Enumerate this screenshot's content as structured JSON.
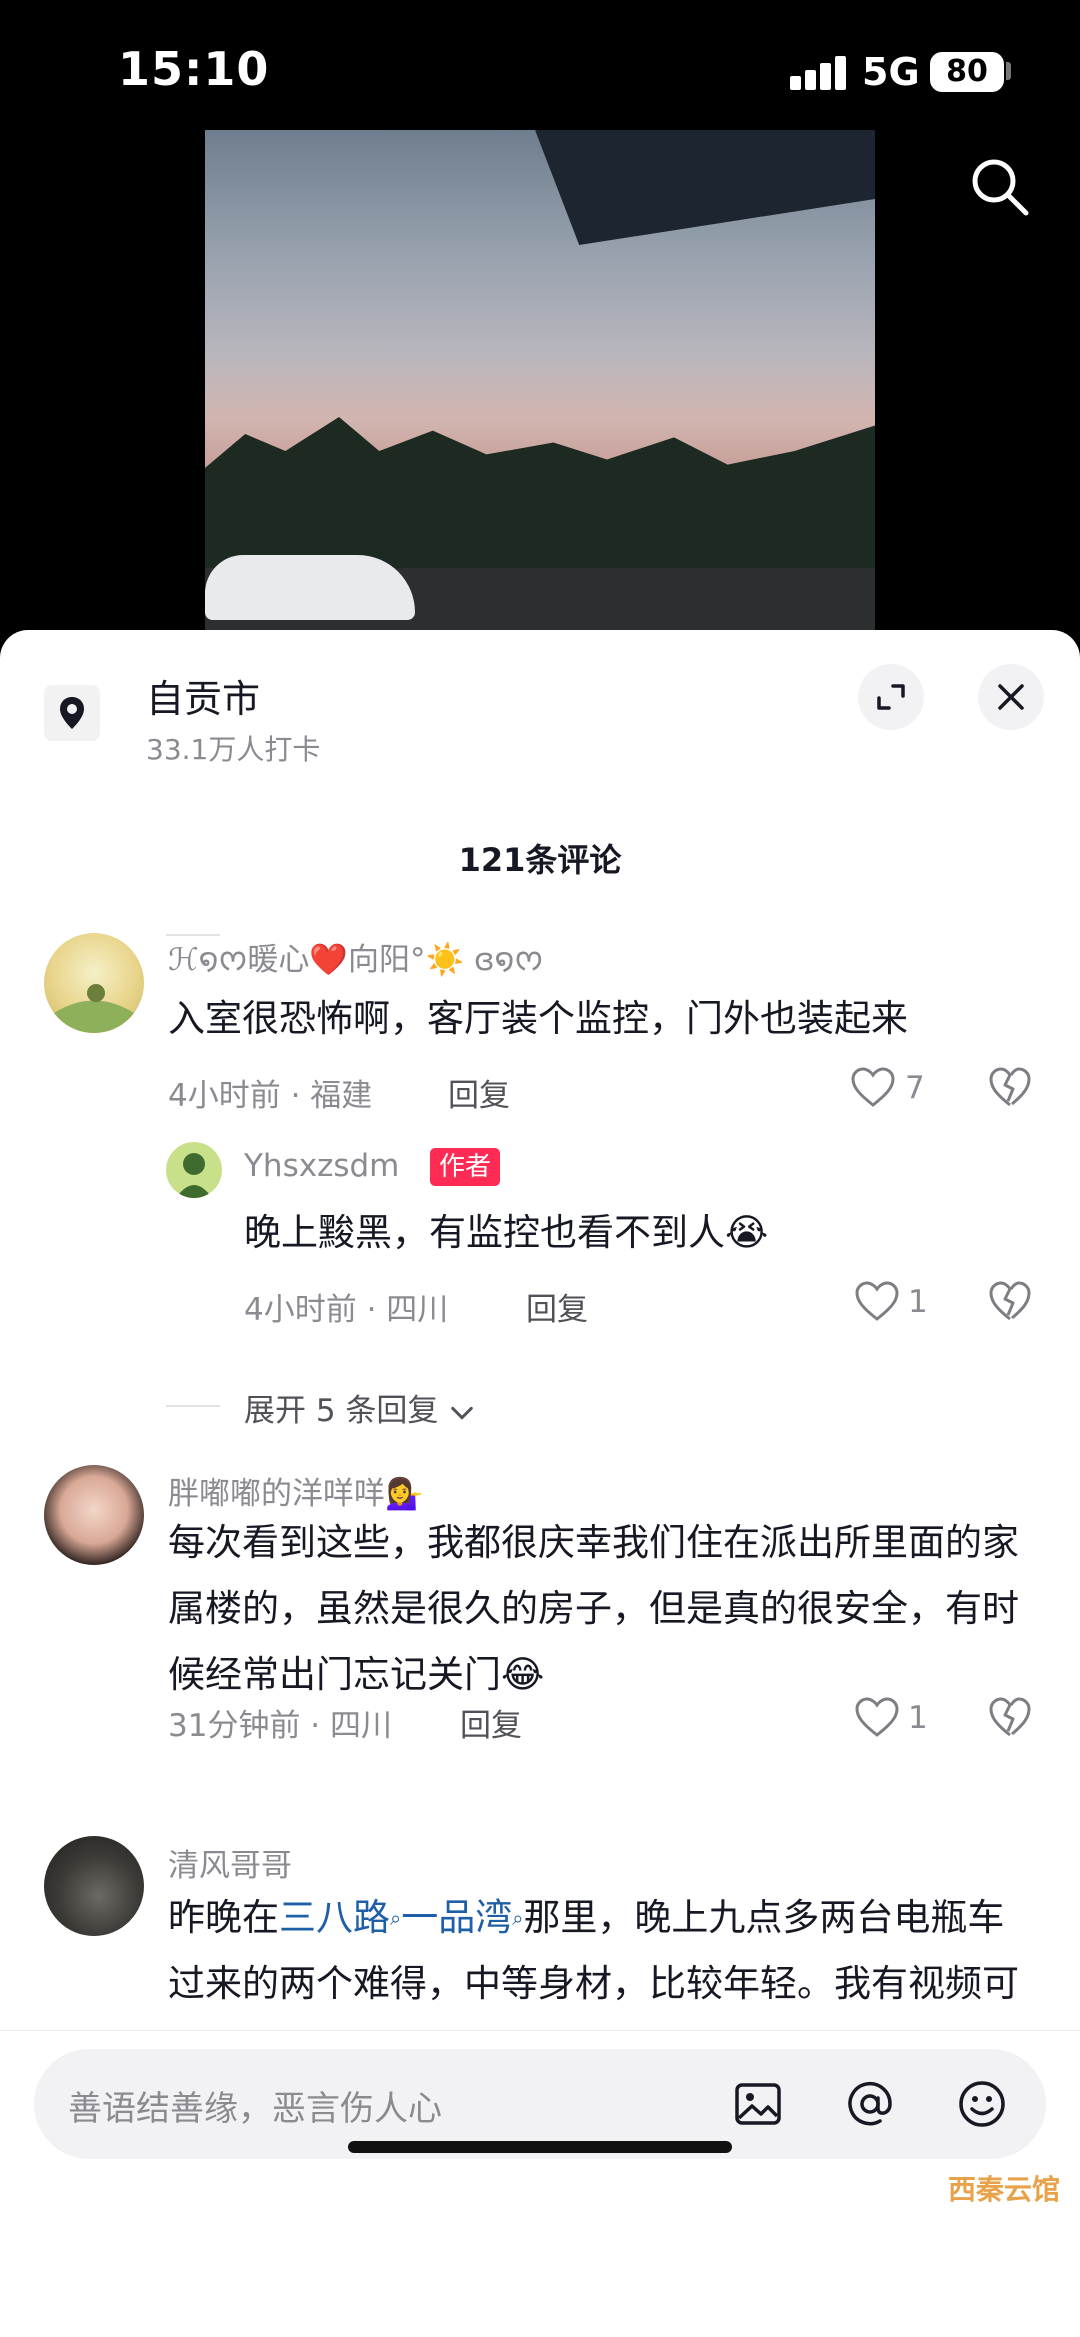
{
  "status": {
    "time": "15:10",
    "network": "5G",
    "battery": "80"
  },
  "location": {
    "name": "自贡市",
    "checkins": "33.1万人打卡"
  },
  "comments_header": "121条评论",
  "comments": [
    {
      "user": "ℋ໑ᰔ暖心❤️向阳°☀️ ɞ໑ᰔ",
      "text": "入室很恐怖啊，客厅装个监控，门外也装起来",
      "meta": "4小时前 · 福建",
      "reply_label": "回复",
      "likes": "7",
      "reply": {
        "user": "Yhsxzsdm",
        "badge": "作者",
        "text": "晚上黢黑，有监控也看不到人😭",
        "meta": "4小时前 · 四川",
        "reply_label": "回复",
        "likes": "1"
      },
      "expand_label": "展开 5 条回复"
    },
    {
      "user": "胖嘟嘟的洋咩咩💁‍♀️",
      "text": "每次看到这些，我都很庆幸我们住在派出所里面的家属楼的，虽然是很久的房子，但是真的很安全，有时候经常出门忘记关门😂",
      "meta": "31分钟前 · 四川",
      "reply_label": "回复",
      "likes": "1"
    },
    {
      "user": "清风哥哥",
      "text_pre": "昨晚在",
      "link1": "三八路",
      "link2": "一品湾",
      "text_post": "那里，晚上九点多两台电瓶车过来的两个难得，中等身材，比较年轻。我有视频可以报警不。小偷真可恶"
    }
  ],
  "input": {
    "placeholder": "善语结善缘，恶言伤人心"
  },
  "watermark": "西秦云馆"
}
